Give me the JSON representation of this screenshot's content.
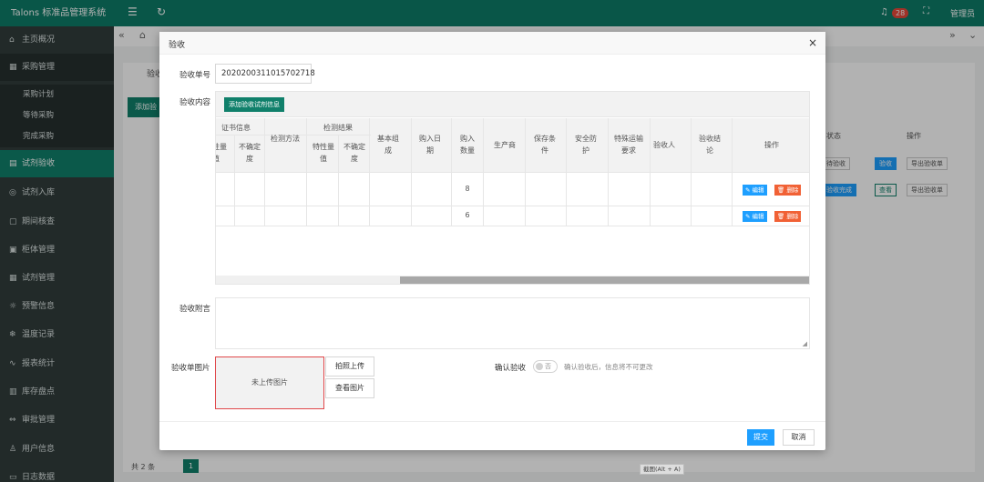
{
  "app": {
    "title": "Talons 标准品管理系统",
    "notif_count": "28",
    "user": "管理员"
  },
  "sidebar": {
    "items": [
      {
        "icon": "⌂",
        "label": "主页概况"
      },
      {
        "icon": "▦",
        "label": "采购管理"
      },
      {
        "icon": "▤",
        "label": "试剂验收"
      },
      {
        "icon": "◎",
        "label": "试剂入库"
      },
      {
        "icon": "▢",
        "label": "期间核查"
      },
      {
        "icon": "▣",
        "label": "柜体管理"
      },
      {
        "icon": "▦",
        "label": "试剂管理"
      },
      {
        "icon": "☼",
        "label": "预警信息"
      },
      {
        "icon": "❄",
        "label": "温度记录"
      },
      {
        "icon": "∿",
        "label": "报表统计"
      },
      {
        "icon": "▥",
        "label": "库存盘点"
      },
      {
        "icon": "⇔",
        "label": "审批管理"
      },
      {
        "icon": "♙",
        "label": "用户信息"
      },
      {
        "icon": "▭",
        "label": "日志数据"
      }
    ],
    "sub_items": [
      "采购计划",
      "等待采购",
      "完成采购"
    ]
  },
  "background": {
    "label": "验收",
    "add_label": "添加验",
    "col_status": "状态",
    "col_action": "操作",
    "rows": [
      {
        "status": "待验收",
        "btn1": "验收",
        "btn2": "导出验收单"
      },
      {
        "status": "验收完成",
        "btn1": "查看",
        "btn2": "导出验收单"
      }
    ],
    "pager_total": "共 2 条",
    "pager_current": "1"
  },
  "modal": {
    "title": "验收",
    "close": "×",
    "order_no_label": "验收单号",
    "order_no_value": "2020200311015702718",
    "content_label": "验收内容",
    "add_button": "添加验收试剂信息",
    "headers": {
      "cert_group": "证书信息",
      "cert_a": "特性量值",
      "cert_b": "不确定度",
      "method": "检测方法",
      "result_group": "检测结果",
      "res_a": "特性量值",
      "res_b": "不确定度",
      "matrix": "基本组成",
      "buy_date": "购入日期",
      "qty": "购入数量",
      "maker": "生产商",
      "storage": "保存条件",
      "safety": "安全防护",
      "transport": "特殊运输要求",
      "inspector": "验收人",
      "conclusion": "验收结论",
      "ops": "操作"
    },
    "rows": [
      {
        "qty": "8",
        "edit": "编辑",
        "del": "删除"
      },
      {
        "qty": "6",
        "edit": "编辑",
        "del": "删除"
      }
    ],
    "attach_label": "验收附言",
    "attach_value": "",
    "image_label": "验收单图片",
    "image_placeholder": "未上传图片",
    "photo_button": "拍照上传",
    "view_button": "查看图片",
    "confirm_label": "确认验收",
    "toggle_text": "否",
    "confirm_hint": "确认验收后，信息将不可更改",
    "submit": "提交",
    "cancel": "取消"
  },
  "tooltip": "截图(Alt + A)"
}
